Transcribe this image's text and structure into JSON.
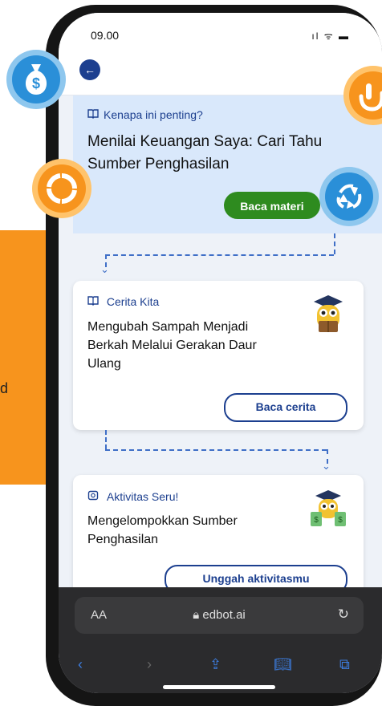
{
  "status_bar": {
    "time": "09.00",
    "icons": "ıl ᯤ ▬"
  },
  "banner": {
    "kicker": "Kenapa ini penting?",
    "title": "Menilai Keuangan Saya: Cari Tahu Sumber Penghasilan",
    "button_label": "Baca materi"
  },
  "cards": [
    {
      "kicker": "Cerita Kita",
      "title": "Mengubah Sampah Menjadi Berkah Melalui Gerakan Daur Ulang",
      "button_label": "Baca cerita"
    },
    {
      "kicker": "Aktivitas Seru!",
      "title": "Mengelompokkan Sumber Penghasilan",
      "button_label": "Unggah aktivitasmu"
    }
  ],
  "browser": {
    "text_size_label": "AA",
    "url": "edbot.ai"
  },
  "left_panel_text": "d",
  "colors": {
    "accent_blue": "#1c3f8f",
    "green_button": "#2e8b1f",
    "orange": "#f7941d",
    "banner_bg": "#d9e8fb"
  },
  "icons": [
    "money-bag-icon",
    "hand-pointer-icon",
    "refresh-ring-icon",
    "recycle-icon",
    "book-icon",
    "activity-icon",
    "owl-graduate-icon",
    "owl-money-icon",
    "back-arrow-icon"
  ]
}
